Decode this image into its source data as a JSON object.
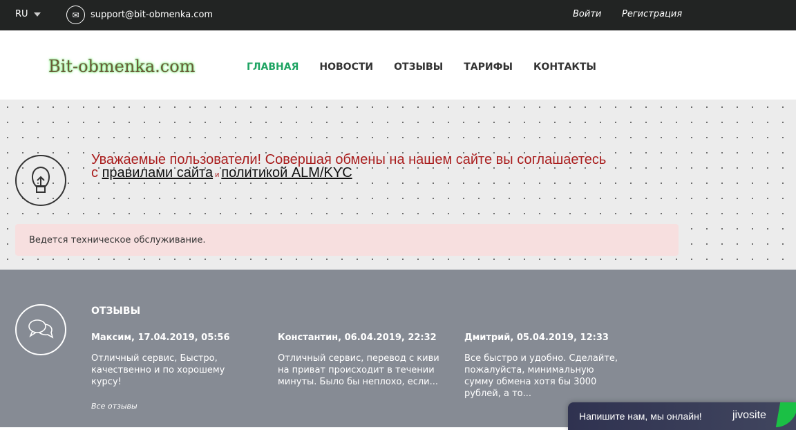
{
  "topbar": {
    "lang": "RU",
    "email": "support@bit-obmenka.com",
    "login": "Войти",
    "register": "Регистрация"
  },
  "header": {
    "logo": "Bit-obmenka.com",
    "nav": [
      "ГЛАВНАЯ",
      "НОВОСТИ",
      "ОТЗЫВЫ",
      "ТАРИФЫ",
      "КОНТАКТЫ"
    ]
  },
  "notice": {
    "line1": "Уважаемые пользователи! Совершая обмены на нашем сайте вы соглашаетесь",
    "prefix": "с ",
    "rules": "правилами сайта",
    "and": " и ",
    "policy": "политикой ALM/KYC"
  },
  "alert": "Ведется техническое обслуживание.",
  "reviews": {
    "title": "ОТЗЫВЫ",
    "items": [
      {
        "who": "Максим, 17.04.2019, 05:56",
        "text": "Отличный сервис, Быстро, качественно и по хорошему курсу!"
      },
      {
        "who": "Константин, 06.04.2019, 22:32",
        "text": "Отличный сервис, перевод с киви на приват происходит в течении минуты. Было бы неплохо, если..."
      },
      {
        "who": "Дмитрий, 05.04.2019, 12:33",
        "text": "Все быстро и удобно. Сделайте, пожалуйста, минимальную сумму обмена хотя бы 3000 рублей, а то..."
      }
    ],
    "all": "Все отзывы"
  },
  "chat": {
    "text": "Напишите нам, мы онлайн!",
    "brand": "jivosite"
  }
}
